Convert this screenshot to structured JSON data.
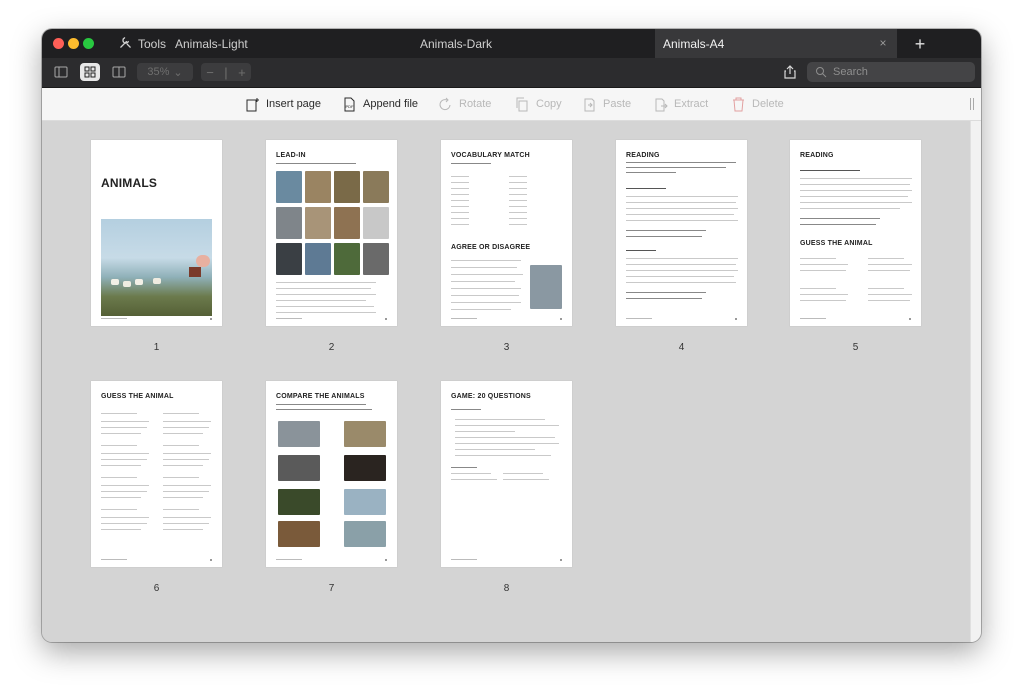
{
  "titlebar": {
    "tools_label": "Tools",
    "tabs": [
      {
        "label": "Animals-Light"
      },
      {
        "label": "Animals-Dark"
      },
      {
        "label": "Animals-A4"
      }
    ],
    "close_glyph": "×",
    "add_glyph": "+"
  },
  "toolbar": {
    "zoom_value": "35%",
    "zoom_out": "−",
    "zoom_in": "+",
    "search_placeholder": "Search"
  },
  "actions": {
    "insert_page": "Insert page",
    "append_file": "Append file",
    "rotate": "Rotate",
    "copy": "Copy",
    "paste": "Paste",
    "extract": "Extract",
    "delete": "Delete"
  },
  "pages": [
    {
      "number": "1",
      "title": "ANIMALS"
    },
    {
      "number": "2",
      "title": "LEAD-IN"
    },
    {
      "number": "3",
      "title": "VOCABULARY MATCH",
      "title2": "AGREE OR DISAGREE"
    },
    {
      "number": "4",
      "title": "READING"
    },
    {
      "number": "5",
      "title": "READING",
      "title2": "GUESS THE ANIMAL"
    },
    {
      "number": "6",
      "title": "GUESS THE ANIMAL"
    },
    {
      "number": "7",
      "title": "COMPARE THE ANIMALS"
    },
    {
      "number": "8",
      "title": "GAME: 20 QUESTIONS"
    }
  ],
  "colors": {
    "titlebar": "#1f1f21",
    "toolbar": "#2c2c2e",
    "canvas": "#d4d4d4",
    "active_tab": "#38383a"
  }
}
